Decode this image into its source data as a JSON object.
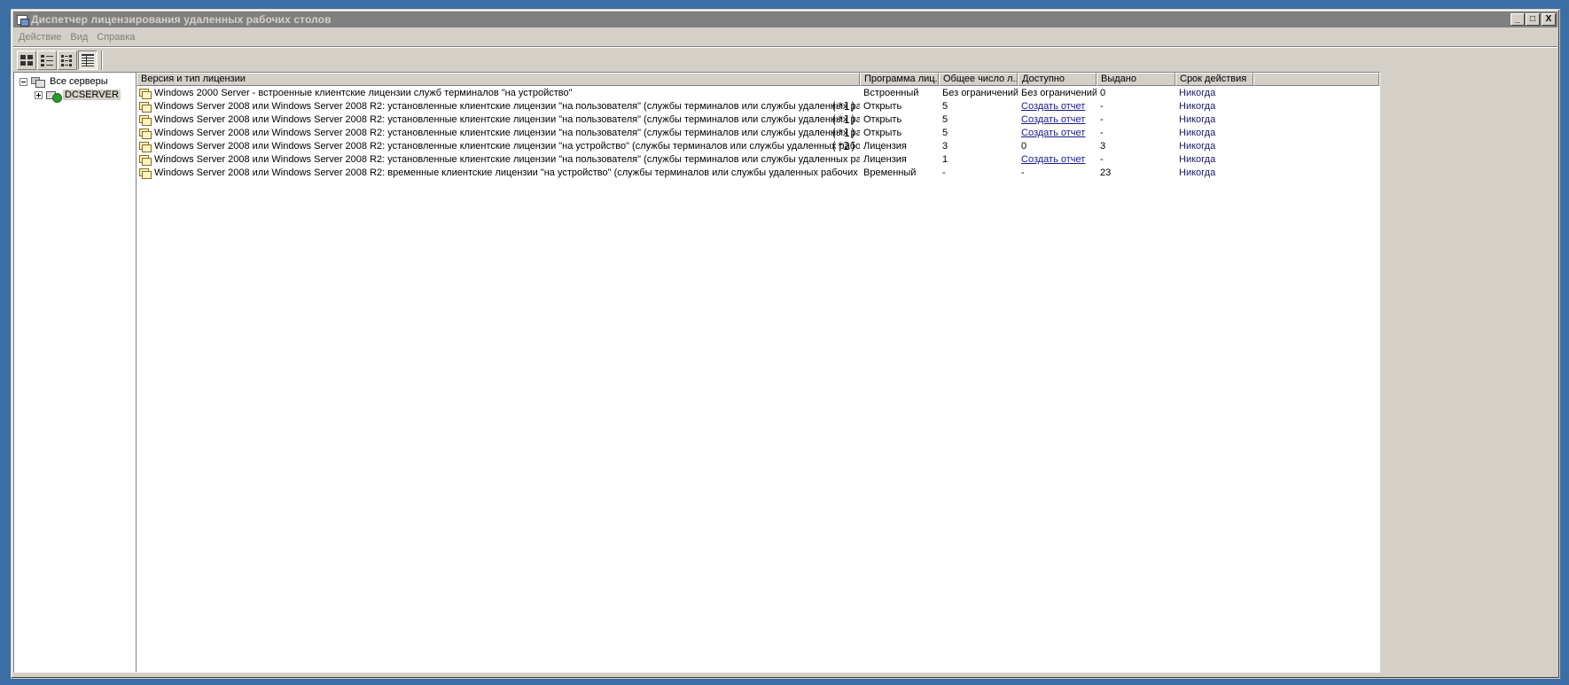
{
  "window": {
    "title": "Диспетчер лицензирования удаленных рабочих столов",
    "buttons": {
      "minimize": "_",
      "maximize": "□",
      "close": "X"
    }
  },
  "menu": [
    "Действие",
    "Вид",
    "Справка"
  ],
  "toolbar": {
    "buttons": [
      {
        "name": "large-icons-view-icon",
        "pressed": false
      },
      {
        "name": "small-icons-view-icon",
        "pressed": false
      },
      {
        "name": "list-view-icon",
        "pressed": false
      },
      {
        "name": "details-view-icon",
        "pressed": true
      }
    ]
  },
  "tree": {
    "root_label": "Все серверы",
    "child_label": "DCSERVER"
  },
  "table": {
    "columns": [
      "Версия и тип лицензии",
      "Программа лиц...",
      "Общее число л...",
      "Доступно",
      "Выдано",
      "Срок действия"
    ],
    "rows": [
      {
        "version": "Windows 2000 Server - встроенные клиентские лицензии служб терминалов \"на устройство\"",
        "note": "",
        "program": "Встроенный",
        "total": "Без ограничений",
        "available": "Без ограничений",
        "available_link": false,
        "issued": "0",
        "expires": "Никогда"
      },
      {
        "version": "Windows Server 2008 или Windows Server 2008 R2: установленные клиентские лицензии \"на пользователя\" (службы терминалов или службы удаленных рабочих столов)",
        "note": "(*1)",
        "program": "Открыть",
        "total": "5",
        "available": "Создать отчет",
        "available_link": true,
        "issued": "-",
        "expires": "Никогда"
      },
      {
        "version": "Windows Server 2008 или Windows Server 2008 R2: установленные клиентские лицензии \"на пользователя\" (службы терминалов или службы удаленных рабочих столов)",
        "note": "(*1)",
        "program": "Открыть",
        "total": "5",
        "available": "Создать отчет",
        "available_link": true,
        "issued": "-",
        "expires": "Никогда"
      },
      {
        "version": "Windows Server 2008 или Windows Server 2008 R2: установленные клиентские лицензии \"на пользователя\" (службы терминалов или службы удаленных рабочих столов)",
        "note": "(*1)",
        "program": "Открыть",
        "total": "5",
        "available": "Создать отчет",
        "available_link": true,
        "issued": "-",
        "expires": "Никогда"
      },
      {
        "version": "Windows Server 2008 или Windows Server 2008 R2: установленные клиентские лицензии \"на устройство\" (службы терминалов или службы удаленных рабочих столов)",
        "note": "(*2)",
        "program": "Лицензия",
        "total": "3",
        "available": "0",
        "available_link": false,
        "issued": "3",
        "expires": "Никогда"
      },
      {
        "version": "Windows Server 2008 или Windows Server 2008 R2: установленные клиентские лицензии \"на пользователя\" (службы терминалов или службы удаленных рабочих столов)",
        "note": "",
        "program": "Лицензия",
        "total": "1",
        "available": "Создать отчет",
        "available_link": true,
        "issued": "-",
        "expires": "Никогда"
      },
      {
        "version": "Windows Server 2008 или Windows Server 2008 R2: временные клиентские лицензии \"на устройство\" (службы терминалов или службы удаленных рабочих столов)",
        "note": "",
        "program": "Временный",
        "total": "-",
        "available": "-",
        "available_link": false,
        "issued": "23",
        "expires": "Никогда"
      }
    ]
  }
}
